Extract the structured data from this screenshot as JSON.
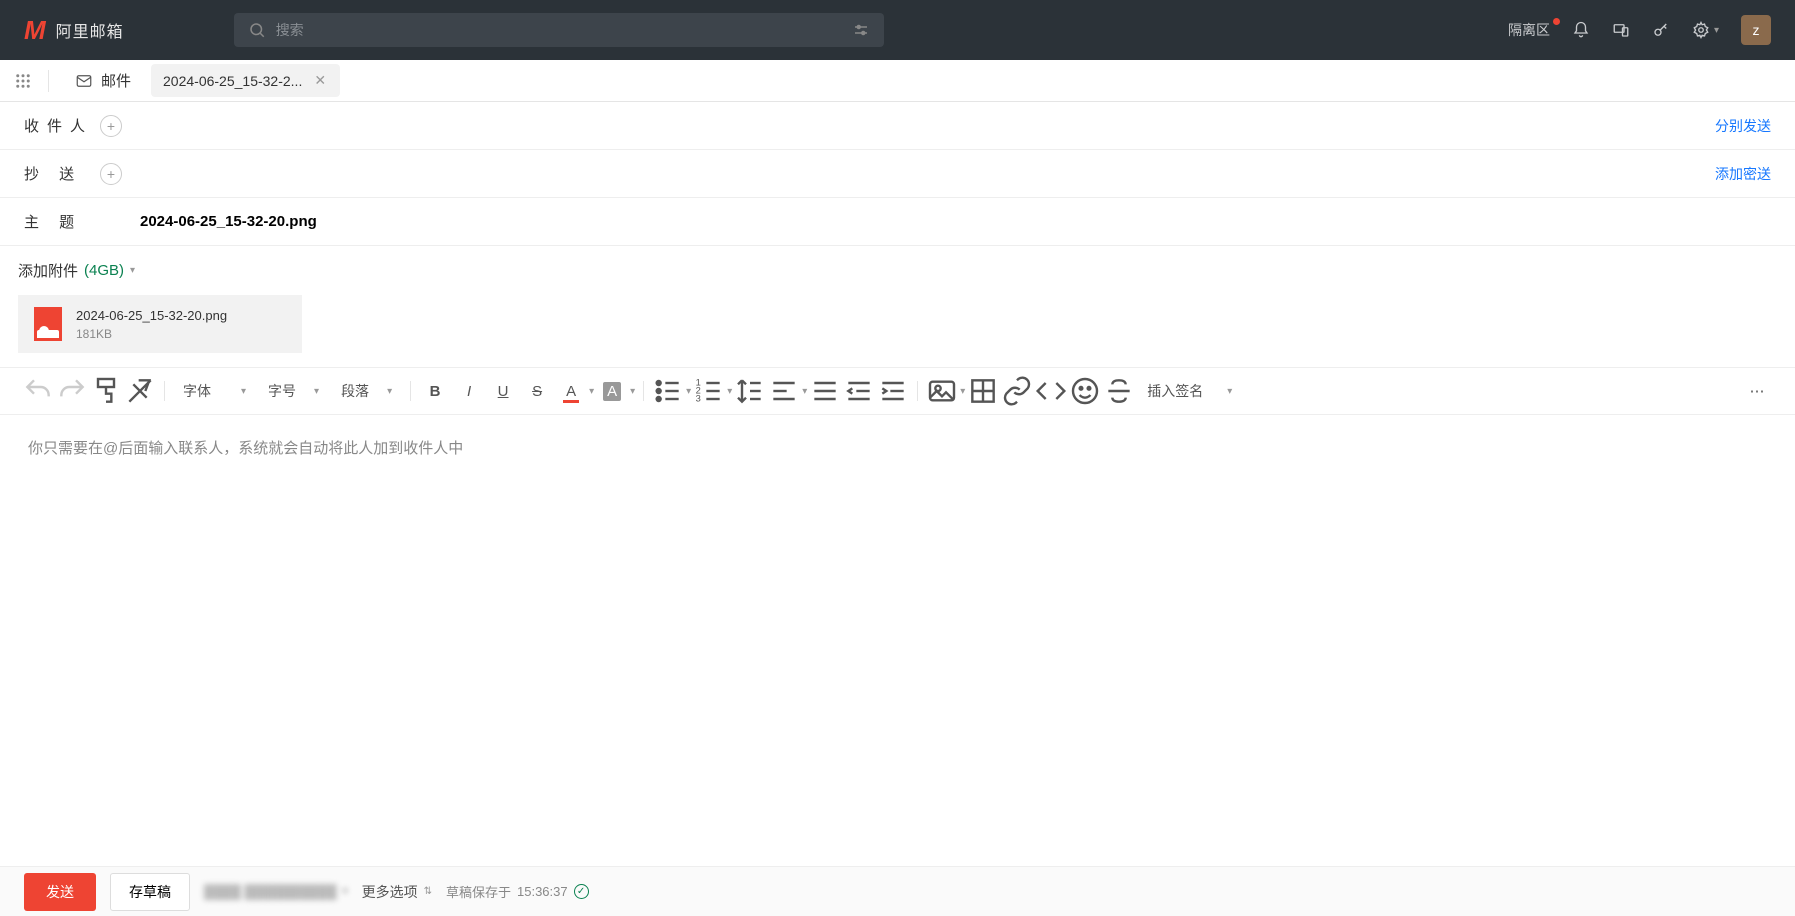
{
  "header": {
    "brand": "阿里邮箱",
    "search_placeholder": "搜索",
    "quarantine": "隔离区",
    "avatar_letter": "z"
  },
  "tabs": {
    "mail_label": "邮件",
    "compose_label": "2024-06-25_15-32-2..."
  },
  "compose": {
    "to_label": "收件人",
    "cc_label": "抄 送",
    "subject_label": "主 题",
    "subject_value": "2024-06-25_15-32-20.png",
    "send_separate": "分别发送",
    "add_bcc": "添加密送"
  },
  "attachment": {
    "add_label": "添加附件",
    "limit": "(4GB)",
    "file_name": "2024-06-25_15-32-20.png",
    "file_size": "181KB"
  },
  "toolbar": {
    "font_family": "字体",
    "font_size": "字号",
    "paragraph": "段落",
    "signature": "插入签名"
  },
  "editor": {
    "placeholder": "你只需要在@后面输入联系人，系统就会自动将此人加到收件人中"
  },
  "footer": {
    "send": "发送",
    "save_draft": "存草稿",
    "sender_masked": "████ ██████████",
    "more_options": "更多选项",
    "saved_prefix": "草稿保存于",
    "saved_time": "15:36:37"
  }
}
